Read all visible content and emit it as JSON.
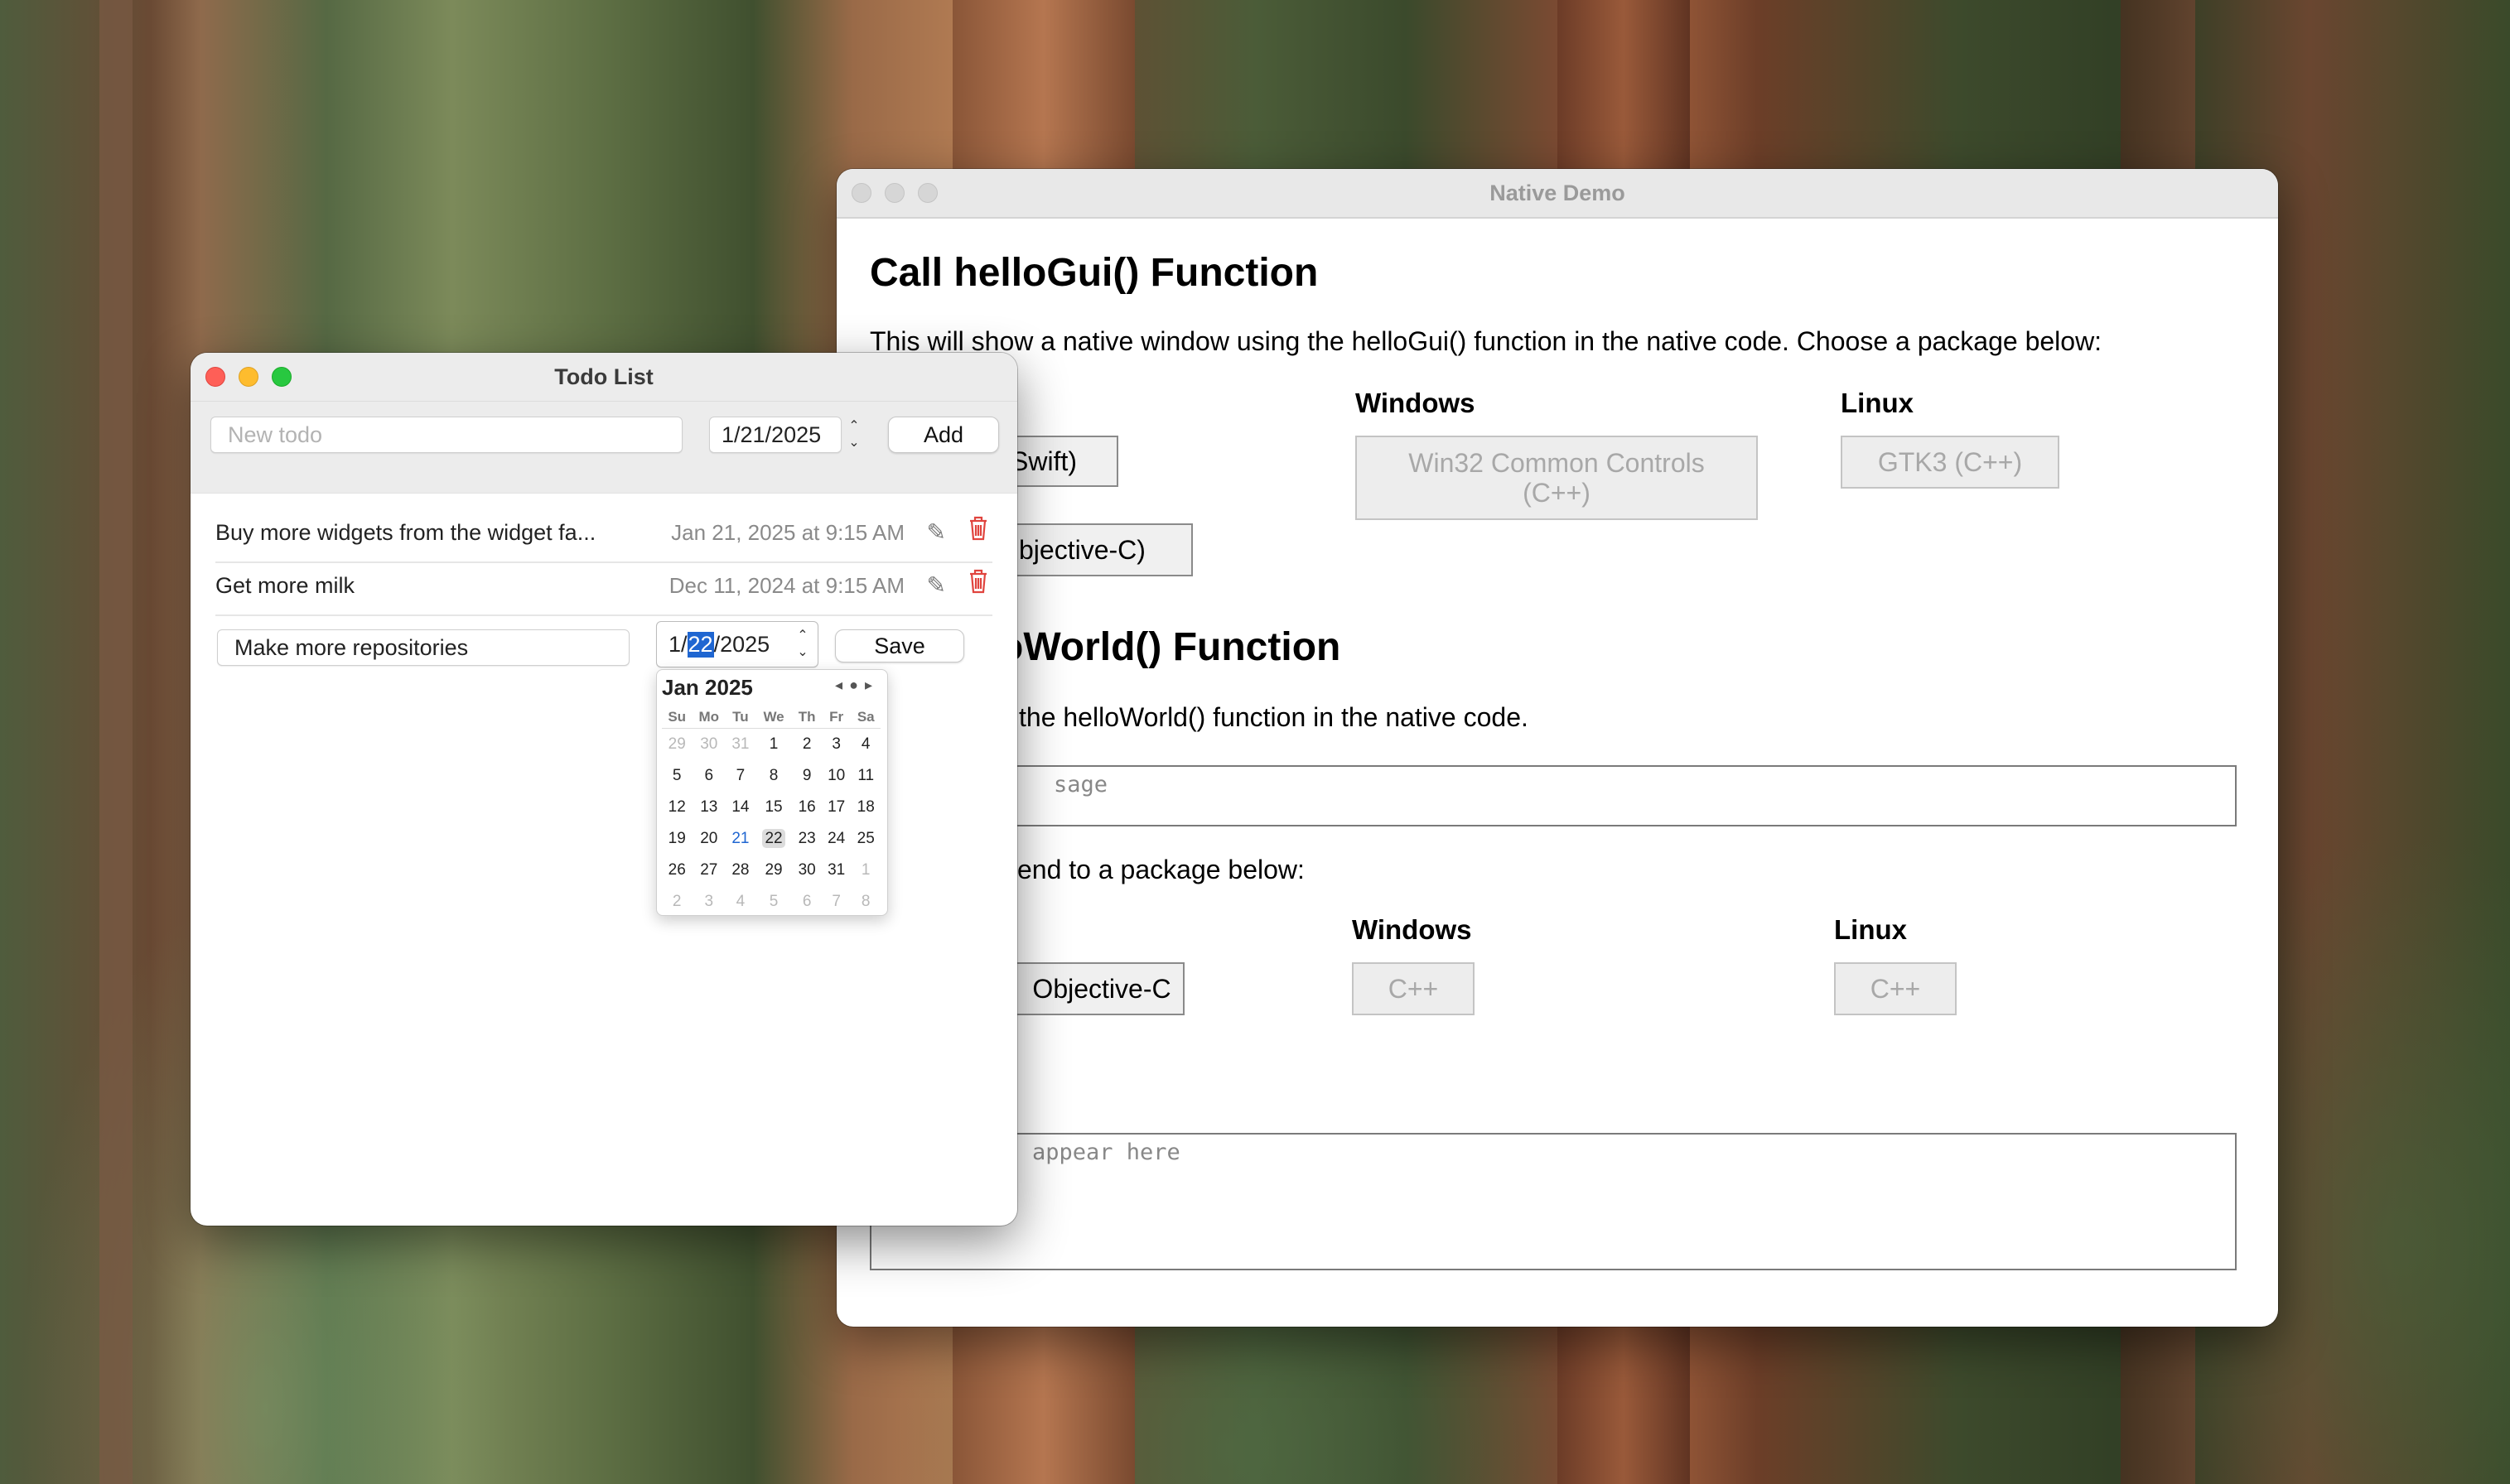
{
  "native_demo": {
    "window_title": "Native Demo",
    "section1": {
      "heading": "Call helloGui() Function",
      "description": "This will show a native window using the helloGui() function in the native code. Choose a package below:",
      "col_windows": "Windows",
      "col_linux": "Linux",
      "btn_swift": "Swift)",
      "btn_objc": "bjective-C)",
      "btn_win32": "Win32 Common Controls (C++)",
      "btn_gtk3": "GTK3 (C++)"
    },
    "section2": {
      "heading": "oWorld() Function",
      "description": "the helloWorld() function in the native code.",
      "message_placeholder": "sage",
      "send_text": "end to a package below:",
      "col_windows": "Windows",
      "col_linux": "Linux",
      "btn_objc": "Objective-C",
      "btn_win_cpp": "C++",
      "btn_linux_cpp": "C++",
      "output_placeholder": "appear here"
    }
  },
  "todo": {
    "window_title": "Todo List",
    "new_todo_placeholder": "New todo",
    "new_date": "1/21/2025",
    "add_label": "Add",
    "items": [
      {
        "title": "Buy more widgets from the widget fa...",
        "date": "Jan 21, 2025 at 9:15 AM"
      },
      {
        "title": "Get more milk",
        "date": "Dec 11, 2024 at 9:15 AM"
      }
    ],
    "editing": {
      "title": "Make more repositories",
      "date_month": "1/",
      "date_day": "22",
      "date_year": "/2025",
      "save_label": "Save"
    },
    "calendar": {
      "month_label": "Jan 2025",
      "weekdays": [
        "Su",
        "Mo",
        "Tu",
        "We",
        "Th",
        "Fr",
        "Sa"
      ],
      "weeks": [
        [
          "29",
          "30",
          "31",
          "1",
          "2",
          "3",
          "4"
        ],
        [
          "5",
          "6",
          "7",
          "8",
          "9",
          "10",
          "11"
        ],
        [
          "12",
          "13",
          "14",
          "15",
          "16",
          "17",
          "18"
        ],
        [
          "19",
          "20",
          "21",
          "22",
          "23",
          "24",
          "25"
        ],
        [
          "26",
          "27",
          "28",
          "29",
          "30",
          "31",
          "1"
        ],
        [
          "2",
          "3",
          "4",
          "5",
          "6",
          "7",
          "8"
        ]
      ],
      "today": "21",
      "selected": "22"
    }
  },
  "colors": {
    "accent": "#1f66d1",
    "trash": "#e0443e"
  }
}
